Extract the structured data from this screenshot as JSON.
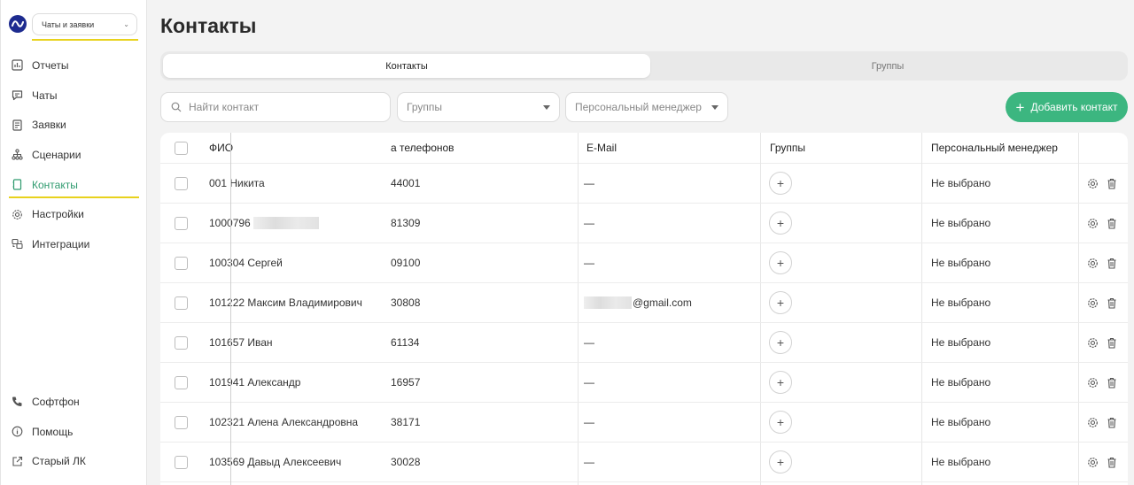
{
  "sidebar": {
    "mode_select": {
      "value": "Чаты и заявки"
    },
    "nav": [
      {
        "label": "Отчеты",
        "icon": "reports-icon",
        "active": false
      },
      {
        "label": "Чаты",
        "icon": "chat-icon",
        "active": false
      },
      {
        "label": "Заявки",
        "icon": "requests-icon",
        "active": false
      },
      {
        "label": "Сценарии",
        "icon": "scenarios-icon",
        "active": false
      },
      {
        "label": "Контакты",
        "icon": "contacts-icon",
        "active": true
      },
      {
        "label": "Настройки",
        "icon": "gear-icon",
        "active": false
      },
      {
        "label": "Интеграции",
        "icon": "integrations-icon",
        "active": false
      }
    ],
    "bottom_nav": [
      {
        "label": "Софтфон",
        "icon": "phone-icon"
      },
      {
        "label": "Помощь",
        "icon": "help-icon"
      },
      {
        "label": "Старый ЛК",
        "icon": "external-link-icon"
      }
    ]
  },
  "page": {
    "title": "Контакты"
  },
  "tabs": [
    {
      "label": "Контакты",
      "active": true
    },
    {
      "label": "Группы",
      "active": false
    }
  ],
  "filters": {
    "search_placeholder": "Найти контакт",
    "groups_placeholder": "Группы",
    "manager_placeholder": "Персональный менеджер"
  },
  "add_button": {
    "label": "Добавить контакт"
  },
  "table": {
    "headers": {
      "name": "ФИО",
      "phones": "а телефонов",
      "email": "E-Mail",
      "groups": "Группы",
      "manager": "Персональный менеджер"
    },
    "rows": [
      {
        "name": "001 Никита",
        "phone": "44001",
        "email": "—",
        "manager": "Не выбрано"
      },
      {
        "name": "1000796",
        "phone": "81309",
        "email": "—",
        "manager": "Не выбрано"
      },
      {
        "name": "100304 Сергей",
        "phone": "09100",
        "email": "—",
        "manager": "Не выбрано"
      },
      {
        "name": "101222 Максим Владимирович",
        "phone": "30808",
        "email": "@gmail.com",
        "manager": "Не выбрано"
      },
      {
        "name": "101657 Иван",
        "phone": "61134",
        "email": "—",
        "manager": "Не выбрано"
      },
      {
        "name": "101941 Александр",
        "phone": "16957",
        "email": "—",
        "manager": "Не выбрано"
      },
      {
        "name": "102321 Алена Александровна",
        "phone": "38171",
        "email": "—",
        "manager": "Не выбрано"
      },
      {
        "name": "103569 Давыд Алексеевич",
        "phone": "30028",
        "email": "—",
        "manager": "Не выбрано"
      }
    ]
  },
  "colors": {
    "accent": "#3cb680",
    "active_nav": "#2e9a6e",
    "highlight": "#e8d21d",
    "logo": "#1d2b8f"
  }
}
